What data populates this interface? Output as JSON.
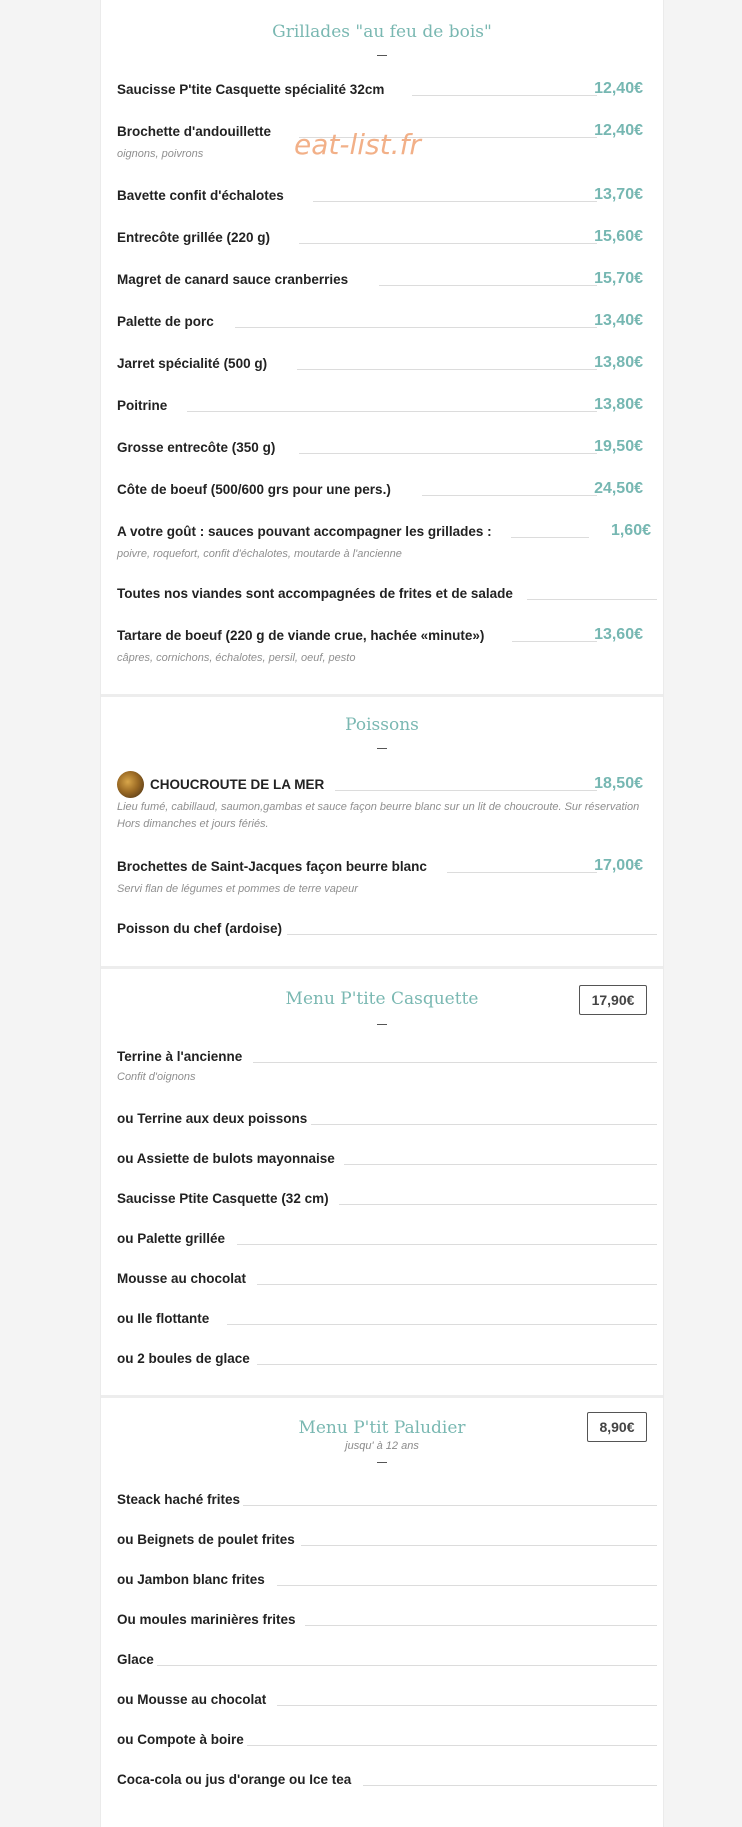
{
  "watermark": "eat-list.fr",
  "grillades": {
    "title": "Grillades \"au feu de bois\"",
    "items": [
      {
        "name": "Saucisse P'tite Casquette spécialité 32cm",
        "price": "12,40€",
        "desc": ""
      },
      {
        "name": "Brochette d'andouillette",
        "price": "12,40€",
        "desc": "oignons, poivrons"
      },
      {
        "name": "Bavette confit d'échalotes",
        "price": "13,70€",
        "desc": ""
      },
      {
        "name": "Entrecôte grillée (220 g)",
        "price": "15,60€",
        "desc": ""
      },
      {
        "name": "Magret de canard sauce cranberries",
        "price": "15,70€",
        "desc": ""
      },
      {
        "name": "Palette de porc",
        "price": "13,40€",
        "desc": ""
      },
      {
        "name": "Jarret spécialité (500 g)",
        "price": "13,80€",
        "desc": ""
      },
      {
        "name": "Poitrine",
        "price": "13,80€",
        "desc": ""
      },
      {
        "name": "Grosse entrecôte (350 g)",
        "price": "19,50€",
        "desc": ""
      },
      {
        "name": "Côte de boeuf (500/600 grs pour une pers.)",
        "price": "24,50€",
        "desc": ""
      },
      {
        "name": "A votre goût : sauces pouvant accompagner les grillades :",
        "price": "1,60€",
        "desc": "poivre, roquefort, confit d'échalotes, moutarde à l'ancienne"
      },
      {
        "name": "Toutes nos viandes sont accompagnées de frites et de salade",
        "price": "",
        "desc": ""
      },
      {
        "name": "Tartare de boeuf (220 g de viande crue, hachée «minute»)",
        "price": "13,60€",
        "desc": "câpres, cornichons, échalotes, persil, oeuf, pesto"
      }
    ]
  },
  "poissons": {
    "title": "Poissons",
    "items": [
      {
        "name": "CHOUCROUTE DE LA MER",
        "price": "18,50€",
        "desc": "Lieu fumé, cabillaud, saumon,gambas et sauce façon beurre blanc sur un lit de choucroute. Sur réservation Hors dimanches et jours fériés."
      },
      {
        "name": "Brochettes de Saint-Jacques façon beurre blanc",
        "price": "17,00€",
        "desc": "Servi flan de légumes et pommes de terre vapeur"
      },
      {
        "name": "Poisson du chef (ardoise)",
        "price": "",
        "desc": ""
      }
    ]
  },
  "menu_casquette": {
    "title": "Menu P'tite Casquette",
    "price": "17,90€",
    "items": [
      {
        "name": "Terrine à l'ancienne",
        "desc": "Confit d'oignons"
      },
      {
        "name": "ou Terrine aux deux poissons",
        "desc": ""
      },
      {
        "name": "ou Assiette de bulots mayonnaise",
        "desc": ""
      },
      {
        "name": "Saucisse Ptite Casquette (32 cm)",
        "desc": ""
      },
      {
        "name": "ou Palette grillée",
        "desc": ""
      },
      {
        "name": "Mousse au chocolat",
        "desc": ""
      },
      {
        "name": "ou Ile flottante",
        "desc": ""
      },
      {
        "name": "ou 2 boules de glace",
        "desc": ""
      }
    ]
  },
  "menu_paludier": {
    "title": "Menu P'tit Paludier",
    "subtitle": "jusqu' à 12 ans",
    "price": "8,90€",
    "items": [
      {
        "name": "Steack haché frites"
      },
      {
        "name": "ou Beignets de poulet frites"
      },
      {
        "name": "ou Jambon blanc frites"
      },
      {
        "name": "Ou moules marinières frites"
      },
      {
        "name": "Glace"
      },
      {
        "name": "ou Mousse au chocolat"
      },
      {
        "name": "ou Compote à boire"
      },
      {
        "name": "Coca-cola ou jus d'orange ou Ice tea"
      }
    ]
  }
}
